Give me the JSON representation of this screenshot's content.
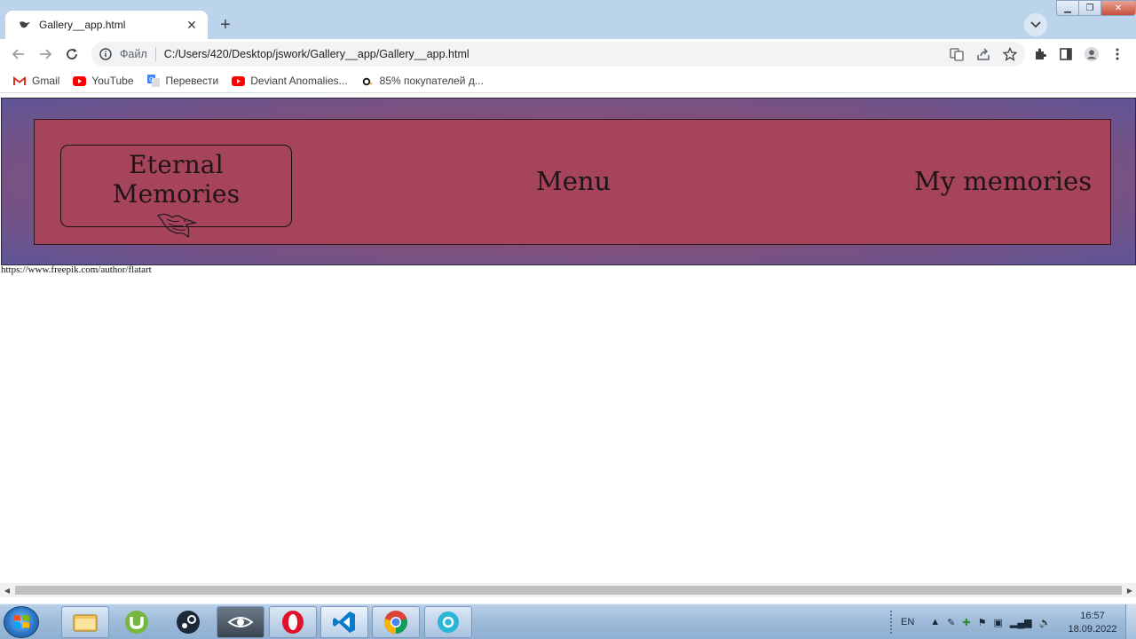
{
  "browser": {
    "tab_title": "Gallery__app.html",
    "omnibox": {
      "scheme_label": "Файл",
      "url": "C:/Users/420/Desktop/jswork/Gallery__app/Gallery__app.html"
    },
    "bookmarks": [
      {
        "label": "Gmail",
        "icon": "gmail-icon"
      },
      {
        "label": "YouTube",
        "icon": "youtube-icon"
      },
      {
        "label": "Перевести",
        "icon": "translate-icon"
      },
      {
        "label": "Deviant Anomalies...",
        "icon": "youtube-icon"
      },
      {
        "label": "85% покупателей д...",
        "icon": "ozon-icon"
      }
    ]
  },
  "page": {
    "logo_title": "Eternal Memories",
    "nav_menu": "Menu",
    "nav_memories": "My memories",
    "credit": "https://www.freepik.com/author/flatart"
  },
  "taskbar": {
    "apps": [
      "explorer",
      "utorrent",
      "steam",
      "eye-app",
      "opera",
      "vscode",
      "chrome",
      "chrome-dev-app"
    ],
    "lang": "EN",
    "time": "16:57",
    "date": "18.09.2022"
  },
  "colors": {
    "tabstrip": "#bcd3ec",
    "header_band": "#8a4f73",
    "header_inner": "#a5445a"
  }
}
